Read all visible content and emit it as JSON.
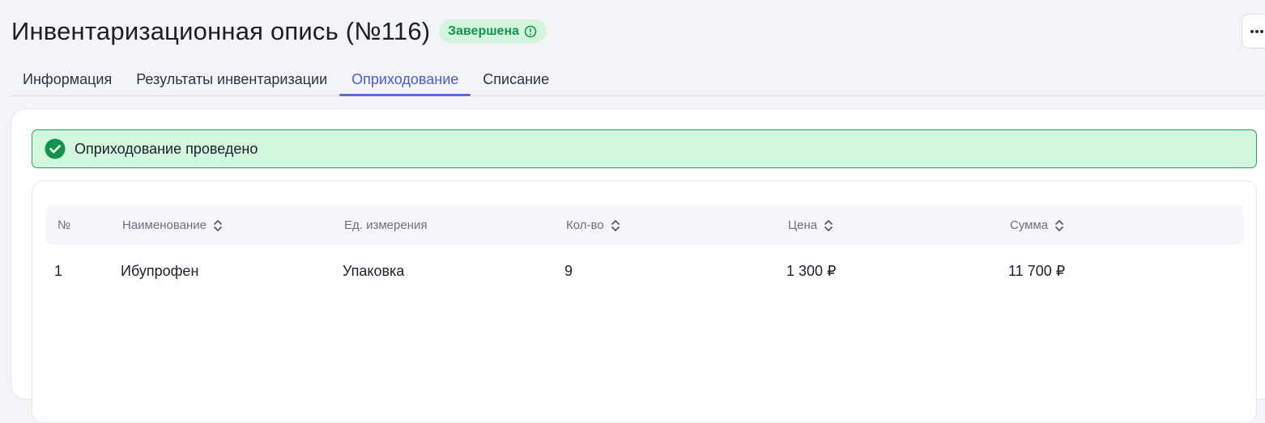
{
  "page": {
    "title": "Инвентаризационная опись (№116)",
    "status": "Завершена",
    "colors": {
      "accent": "#4b5bd8",
      "status_bg": "#d3f5dd",
      "status_text": "#149447",
      "alert_bg": "#d3f7de",
      "alert_border": "#2aa055"
    }
  },
  "tabs": [
    {
      "label": "Информация",
      "active": false
    },
    {
      "label": "Результаты инвентаризации",
      "active": false
    },
    {
      "label": "Оприходование",
      "active": true
    },
    {
      "label": "Списание",
      "active": false
    }
  ],
  "alert": {
    "text": "Оприходование проведено",
    "icon": "check-circle-icon"
  },
  "table": {
    "columns": [
      {
        "label": "№",
        "sortable": false
      },
      {
        "label": "Наименование",
        "sortable": true
      },
      {
        "label": "Ед. измерения",
        "sortable": false
      },
      {
        "label": "Кол-во",
        "sortable": true
      },
      {
        "label": "Цена",
        "sortable": true
      },
      {
        "label": "Сумма",
        "sortable": true
      }
    ],
    "rows": [
      [
        "1",
        "Ибупрофен",
        "Упаковка",
        "9",
        "1 300 ₽",
        "11 700 ₽"
      ]
    ]
  }
}
